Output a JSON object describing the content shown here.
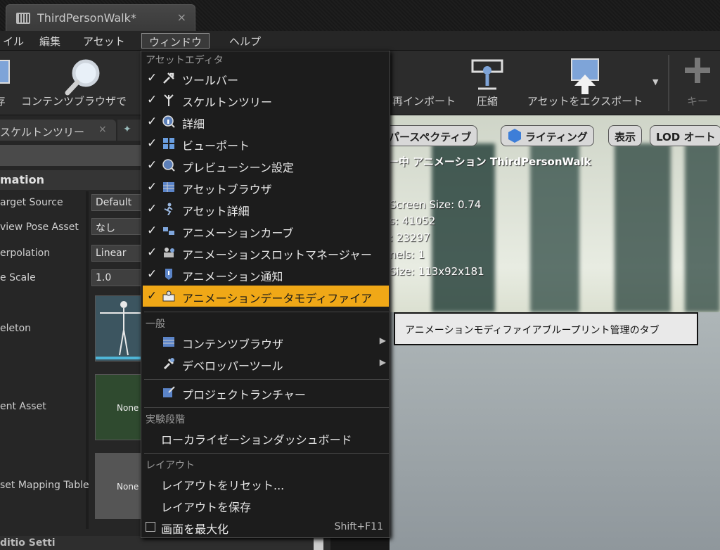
{
  "window": {
    "tab_title": "ThirdPersonWalk*",
    "tab_close": "×"
  },
  "menubar": [
    {
      "label": "イル"
    },
    {
      "label": "編集"
    },
    {
      "label": "アセット"
    },
    {
      "label": "ウィンドウ"
    },
    {
      "label": "ヘルプ"
    }
  ],
  "toolbar": {
    "save_partial": "存",
    "content_browser": "コンテンツブラウザで",
    "reimport_partial": "再インポート",
    "compress": "圧縮",
    "export": "アセットをエクスポート",
    "key": "キー"
  },
  "left_panel": {
    "tab_label": "スケルトンツリー",
    "tab_close": "×",
    "section_title": "mation",
    "props": [
      {
        "label": "arget Source",
        "value": "Default"
      },
      {
        "label": "view Pose Asset",
        "value": "なし"
      },
      {
        "label": "erpolation",
        "value": "Linear"
      },
      {
        "label": "e Scale",
        "value": "1.0"
      },
      {
        "label": "eleton",
        "value": ""
      },
      {
        "label": "ent Asset",
        "value": "None"
      },
      {
        "label": "set Mapping Table",
        "value": "None"
      }
    ],
    "bottom_label": "ditio Setti"
  },
  "viewport": {
    "perspective": "パースペクティブ",
    "lighting": "ライティング",
    "show": "表示",
    "lod": "LOD オート",
    "preview_line": "ー中 アニメーション ThirdPersonWalk",
    "stats": [
      "Screen Size: 0.74",
      "s: 41052",
      ": 23297",
      "nels: 1",
      "Size: 113x92x181"
    ]
  },
  "dropdown": {
    "section_asset_editor": "アセットエディタ",
    "asset_editor_items": [
      {
        "label": "ツールバー",
        "icon": "wrench-icon"
      },
      {
        "label": "スケルトンツリー",
        "icon": "skeleton-tree-icon"
      },
      {
        "label": "詳細",
        "icon": "info-icon"
      },
      {
        "label": "ビューポート",
        "icon": "viewport-icon"
      },
      {
        "label": "プレビューシーン設定",
        "icon": "preview-scene-icon"
      },
      {
        "label": "アセットブラウザ",
        "icon": "asset-browser-icon"
      },
      {
        "label": "アセット詳細",
        "icon": "asset-details-icon"
      },
      {
        "label": "アニメーションカーブ",
        "icon": "curve-icon"
      },
      {
        "label": "アニメーションスロットマネージャー",
        "icon": "slot-manager-icon"
      },
      {
        "label": "アニメーション通知",
        "icon": "notify-icon"
      },
      {
        "label": "アニメーションデータモディファイア",
        "icon": "data-modifier-icon"
      }
    ],
    "section_general": "一般",
    "general_items": [
      {
        "label": "コンテンツブラウザ",
        "icon": "content-browser-icon"
      },
      {
        "label": "デベロッパーツール",
        "icon": "developer-tools-icon"
      },
      {
        "label": "プロジェクトランチャー",
        "icon": "project-launcher-icon"
      }
    ],
    "section_experimental": "実験段階",
    "localization": "ローカライゼーションダッシュボード",
    "section_layout": "レイアウト",
    "reset_layout": "レイアウトをリセット...",
    "save_layout": "レイアウトを保存",
    "maximize": "画面を最大化",
    "maximize_shortcut": "Shift+F11",
    "check": "✓",
    "submenu_arrow": "▶"
  },
  "tooltip": "アニメーションモディファイアブループリント管理のタブ",
  "colors": {
    "highlight": "#f0a817",
    "menu_bg": "#1c1c1c"
  }
}
